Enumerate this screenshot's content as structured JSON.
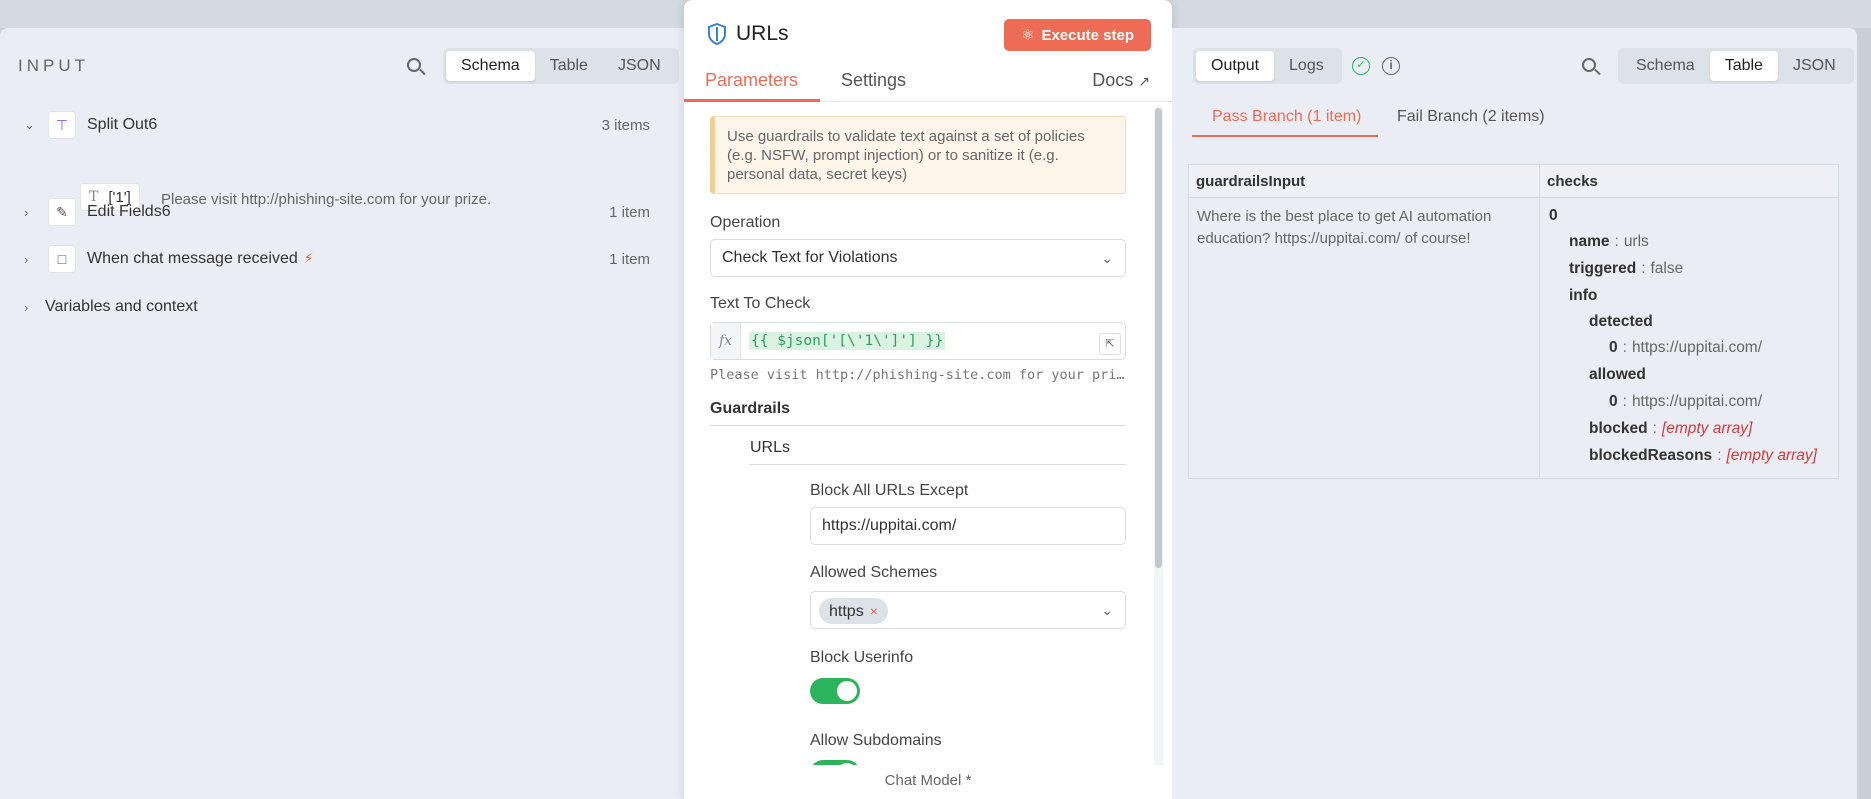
{
  "input_panel": {
    "title": "INPUT",
    "view_tabs": [
      "Schema",
      "Table",
      "JSON"
    ],
    "active_view": "Schema",
    "nodes": [
      {
        "label": "Split Out6",
        "count": "3 items",
        "icon": "split-icon",
        "expanded": true
      },
      {
        "label": "Edit Fields6",
        "count": "1 item",
        "icon": "pencil-icon",
        "expanded": false
      },
      {
        "label": "When chat message received",
        "count": "1 item",
        "icon": "chat-icon",
        "expanded": false,
        "trigger": true
      }
    ],
    "field": {
      "type_icon": "T",
      "key": "['1']",
      "value": "Please visit http://phishing-site.com for your prize."
    },
    "variables_label": "Variables and context"
  },
  "node_panel": {
    "title": "URLs",
    "execute_label": "Execute step",
    "tabs": [
      "Parameters",
      "Settings"
    ],
    "docs_label": "Docs",
    "notice": "Use guardrails to validate text against a set of policies (e.g. NSFW, prompt injection) or to sanitize it (e.g. personal data, secret keys)",
    "operation_label": "Operation",
    "operation_value": "Check Text for Violations",
    "text_label": "Text To Check",
    "text_expression": "{{ $json['[\\'1\\']'] }}",
    "text_preview": "Please visit http://phishing-site.com for your prize.",
    "guardrails_label": "Guardrails",
    "urls_label": "URLs",
    "block_except_label": "Block All URLs Except",
    "block_except_value": "https://uppitai.com/",
    "schemes_label": "Allowed Schemes",
    "schemes": [
      "https"
    ],
    "block_userinfo_label": "Block Userinfo",
    "allow_subdomains_label": "Allow Subdomains",
    "footer": "Chat Model *"
  },
  "output_panel": {
    "tabs": [
      "Output",
      "Logs"
    ],
    "view_tabs": [
      "Schema",
      "Table",
      "JSON"
    ],
    "active_view": "Table",
    "branches": [
      "Pass Branch (1 item)",
      "Fail Branch (2 items)"
    ],
    "columns": [
      "guardrailsInput",
      "checks"
    ],
    "row_input": "Where is the best place to get AI automation education?  https://uppitai.com/ of course!",
    "checks": {
      "index": "0",
      "name_key": "name",
      "name_value": "urls",
      "triggered_key": "triggered",
      "triggered_value": "false",
      "info_key": "info",
      "detected_key": "detected",
      "detected_idx": "0",
      "detected_value": "https://uppitai.com/",
      "allowed_key": "allowed",
      "allowed_idx": "0",
      "allowed_value": "https://uppitai.com/",
      "blocked_key": "blocked",
      "blocked_value": "[empty array]",
      "blocked_reasons_key": "blockedReasons",
      "blocked_reasons_value": "[empty array]"
    }
  },
  "colors": {
    "accent": "#ee6b55",
    "success": "#2bb45c",
    "danger": "#d63a3a"
  }
}
